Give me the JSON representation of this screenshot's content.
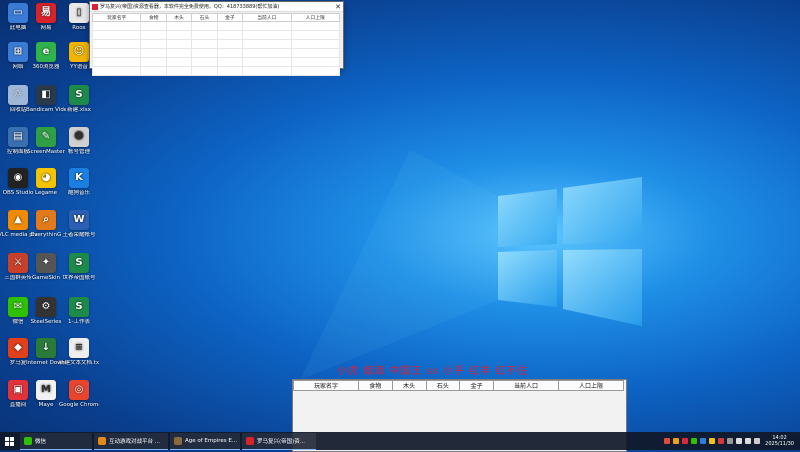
{
  "desktop": {
    "icons": [
      {
        "label": "此电脑",
        "name": "this-pc-icon",
        "color": "#3a7bd5",
        "glyph": "▭"
      },
      {
        "label": "网易",
        "name": "netease-icon",
        "color": "#d8232a",
        "glyph": "易"
      },
      {
        "label": "Roox",
        "name": "roox-icon",
        "color": "#e8e8e8",
        "glyph": "▯"
      },
      {
        "label": "网络",
        "name": "network-icon",
        "color": "#3a7bd5",
        "glyph": "⊞"
      },
      {
        "label": "360浏览器",
        "name": "browser-360-icon",
        "color": "#2fb34a",
        "glyph": "e"
      },
      {
        "label": "YY语音",
        "name": "yy-voice-icon",
        "color": "#f1b500",
        "glyph": "☺"
      },
      {
        "label": "回收站",
        "name": "recycle-bin-icon",
        "color": "#9fb8d8",
        "glyph": "♲"
      },
      {
        "label": "Bandicam Video",
        "name": "bandicam-icon",
        "color": "#2a3a4a",
        "glyph": "◧"
      },
      {
        "label": "新建.xlsx",
        "name": "xlsx-file-icon",
        "color": "#1e8a4a",
        "glyph": "S"
      },
      {
        "label": "控制面板",
        "name": "control-panel-icon",
        "color": "#3a6fb0",
        "glyph": "▤"
      },
      {
        "label": "ScreenMaster",
        "name": "screenmaster-icon",
        "color": "#2f9e44",
        "glyph": "✎"
      },
      {
        "label": "帐号管理",
        "name": "account-icon",
        "color": "#d0d0d0",
        "glyph": "☻"
      },
      {
        "label": "OBS Studio",
        "name": "obs-studio-icon",
        "color": "#222222",
        "glyph": "◉"
      },
      {
        "label": "Legame",
        "name": "legame-icon",
        "color": "#f4c400",
        "glyph": "◕"
      },
      {
        "label": "酷狗音乐",
        "name": "kugou-icon",
        "color": "#1a7fe0",
        "glyph": "K"
      },
      {
        "label": "VLC media player",
        "name": "vlc-icon",
        "color": "#f08a00",
        "glyph": "▲"
      },
      {
        "label": "EverythinG",
        "name": "everything-icon",
        "color": "#e07a1a",
        "glyph": "⌕"
      },
      {
        "label": "王者荣耀帐号",
        "name": "word-doc-icon",
        "color": "#2b5fb4",
        "glyph": "W"
      },
      {
        "label": "三国群英传",
        "name": "sanguo-game-icon",
        "color": "#c8402a",
        "glyph": "⚔"
      },
      {
        "label": "GameSkin",
        "name": "gameskin-icon",
        "color": "#555555",
        "glyph": "✦"
      },
      {
        "label": "世界帝国账号",
        "name": "xlsx-file-2-icon",
        "color": "#1e8a4a",
        "glyph": "S"
      },
      {
        "label": "微信",
        "name": "wechat-icon",
        "color": "#2dc100",
        "glyph": "✉"
      },
      {
        "label": "SteelSeries",
        "name": "steelseries-icon",
        "color": "#333333",
        "glyph": "⚙"
      },
      {
        "label": "1-工作表",
        "name": "xlsx-file-3-icon",
        "color": "#1e8a4a",
        "glyph": "S"
      },
      {
        "label": "罗马复",
        "name": "luoma-icon",
        "color": "#e0401a",
        "glyph": "◆"
      },
      {
        "label": "Internet Download",
        "name": "idm-icon",
        "color": "#2a7a3a",
        "glyph": "↓"
      },
      {
        "label": "新建文本文档.txt",
        "name": "txt-file-icon",
        "color": "#eeeeee",
        "glyph": "≡"
      },
      {
        "label": "直播间",
        "name": "live-room-icon",
        "color": "#e2323a",
        "glyph": "▣"
      },
      {
        "label": "Maye",
        "name": "maye-icon",
        "color": "#f2f2f2",
        "glyph": "M"
      },
      {
        "label": "Google Chrome",
        "name": "chrome-icon",
        "color": "#e8442e",
        "glyph": "◎"
      }
    ]
  },
  "top_window": {
    "title": "罗马复兴(帝国)资源查看器，本软件完全免费使用。QQ：418733889(帮忙加油)",
    "columns": [
      "玩家名字",
      "食物",
      "木头",
      "石头",
      "金子",
      "当前人口",
      "人口上限"
    ]
  },
  "overlay": {
    "text": "小虎 烟酒 中国王 ss 小乎 红羊 红不住"
  },
  "bottom_panel": {
    "columns": [
      "玩家名字",
      "食物",
      "木头",
      "石头",
      "金子",
      "当前人口",
      "人口上限"
    ]
  },
  "taskbar": {
    "buttons": [
      {
        "label": "微信",
        "name": "taskbar-wechat",
        "color": "#2dc100"
      },
      {
        "label": "互动游戏对战平台 ...",
        "name": "taskbar-game-platform",
        "color": "#e38b1a"
      },
      {
        "label": "Age of Empires E...",
        "name": "taskbar-aoe",
        "color": "#8a6a3a"
      },
      {
        "label": "罗马复兴(帝国)资...",
        "name": "taskbar-resource-viewer",
        "color": "#d8232a"
      }
    ],
    "clock_time": "14:02",
    "clock_date": "2025/11/30"
  },
  "colors": {
    "desktop_bg": "#0d63c4",
    "overlay_text": "#d8223a",
    "taskbar_bg": "#101828"
  }
}
